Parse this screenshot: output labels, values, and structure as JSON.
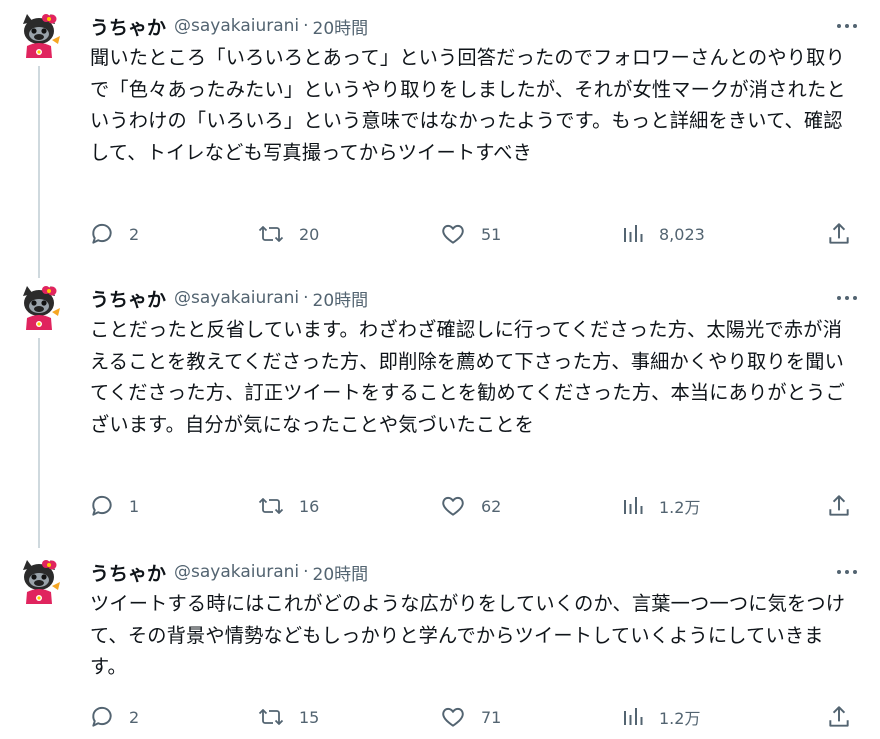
{
  "colors": {
    "text": "#0f1419",
    "secondary": "#536471",
    "thread_line": "#cfd9de"
  },
  "icons": {
    "reply": "speech-bubble-icon",
    "retweet": "retweet-arrows-icon",
    "like": "heart-icon",
    "views": "bar-chart-icon",
    "share": "upload-arrow-icon",
    "more": "ellipsis-icon"
  },
  "tweets": [
    {
      "name": "うちゃか",
      "handle": "@sayakaiurani",
      "dot": "·",
      "time": "20時間",
      "text": "聞いたところ「いろいろとあって」という回答だったのでフォロワーさんとのやり取りで「色々あったみたい」というやり取りをしましたが、それが女性マークが消されたというわけの「いろいろ」という意味ではなかったようです。もっと詳細をきいて、確認して、トイレなども写真撮ってからツイートすべき",
      "replies": "2",
      "retweets": "20",
      "likes": "51",
      "views": "8,023"
    },
    {
      "name": "うちゃか",
      "handle": "@sayakaiurani",
      "dot": "·",
      "time": "20時間",
      "text": "ことだったと反省しています。わざわざ確認しに行ってくださった方、太陽光で赤が消えることを教えてくださった方、即削除を薦めて下さった方、事細かくやり取りを聞いてくださった方、訂正ツイートをすることを勧めてくださった方、本当にありがとうございます。自分が気になったことや気づいたことを",
      "replies": "1",
      "retweets": "16",
      "likes": "62",
      "views": "1.2万"
    },
    {
      "name": "うちゃか",
      "handle": "@sayakaiurani",
      "dot": "·",
      "time": "20時間",
      "text": "ツイートする時にはこれがどのような広がりをしていくのか、言葉一つ一つに気をつけて、その背景や情勢などもしっかりと学んでからツイートしていくようにしていきます。",
      "replies": "2",
      "retweets": "15",
      "likes": "71",
      "views": "1.2万"
    }
  ]
}
